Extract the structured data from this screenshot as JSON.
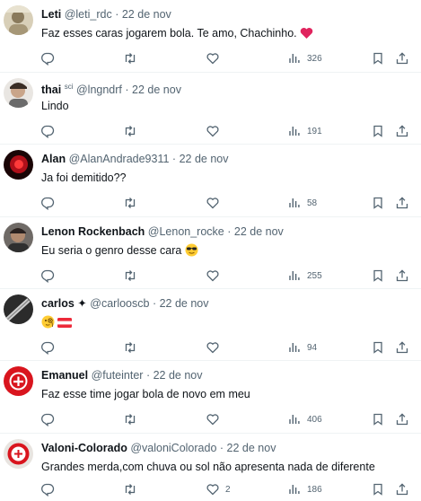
{
  "tweets": [
    {
      "name": "Leti",
      "handle": "@leti_rdc",
      "date": "22 de nov",
      "text": "Faz esses caras jogarem bola. Te amo, Chachinho.",
      "trailing_emoji": "red-heart",
      "replies": "",
      "retweets": "",
      "likes": "",
      "views": "326"
    },
    {
      "name": "thai",
      "name_suffix": "sci",
      "handle": "@lngndrf",
      "date": "22 de nov",
      "text": "Lindo",
      "replies": "",
      "retweets": "",
      "likes": "",
      "views": "191"
    },
    {
      "name": "Alan",
      "handle": "@AlanAndrade9311",
      "date": "22 de nov",
      "text": "Ja foi demitido??",
      "replies": "",
      "retweets": "",
      "likes": "",
      "views": "58"
    },
    {
      "name": "Lenon Rockenbach",
      "handle": "@Lenon_rocke",
      "date": "22 de nov",
      "text": "Eu seria o genro desse cara",
      "trailing_emoji": "sunglasses-face",
      "replies": "",
      "retweets": "",
      "likes": "",
      "views": "255"
    },
    {
      "name": "carlos ✦",
      "handle": "@carlooscb",
      "date": "22 de nov",
      "text": "",
      "emojis": [
        "face-with-monocle",
        "austria-flag"
      ],
      "replies": "",
      "retweets": "",
      "likes": "",
      "views": "94"
    },
    {
      "name": "Emanuel",
      "handle": "@futeinter",
      "date": "22 de nov",
      "text": "Faz esse time jogar bola de novo em meu",
      "replies": "",
      "retweets": "",
      "likes": "",
      "views": "406"
    },
    {
      "name": "Valoni-Colorado",
      "handle": "@valoniColorado",
      "date": "22 de nov",
      "text": "Grandes merda,com chuva ou sol não apresenta nada de diferente",
      "replies": "",
      "retweets": "",
      "likes": "2",
      "views": "186"
    }
  ],
  "separator": "·",
  "colors": {
    "text_primary": "#0f1419",
    "text_secondary": "#536471",
    "divider": "#eff3f4",
    "heart_red": "#e0245e"
  },
  "icons": [
    "reply-icon",
    "retweet-icon",
    "like-icon",
    "views-icon",
    "bookmark-icon",
    "share-icon"
  ]
}
